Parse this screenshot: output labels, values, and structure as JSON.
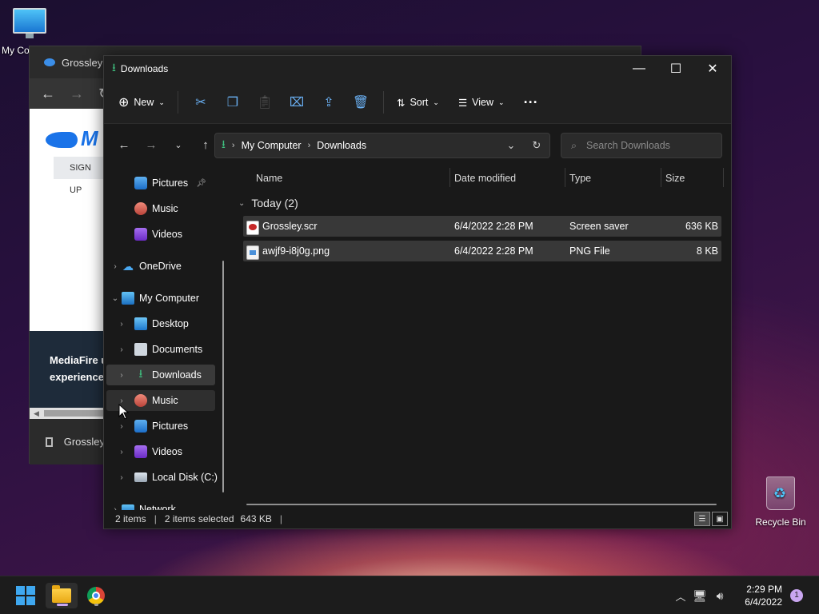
{
  "desktop": {
    "my_computer_label": "My Co",
    "recycle_bin_label": "Recycle Bin"
  },
  "background_window": {
    "tab_title": "Grossley",
    "signup_label": "SIGN UP",
    "promo_line1": "MediaFire u",
    "promo_line2": "experience.",
    "download_item": "Grossley"
  },
  "explorer": {
    "title": "Downloads",
    "commands": {
      "new": "New",
      "sort": "Sort",
      "view": "View"
    },
    "address": {
      "root": "My Computer",
      "folder": "Downloads"
    },
    "search_placeholder": "Search Downloads",
    "nav": {
      "pinned_pictures": "Pictures",
      "pinned_music": "Music",
      "pinned_videos": "Videos",
      "onedrive": "OneDrive",
      "my_computer": "My Computer",
      "desktop": "Desktop",
      "documents": "Documents",
      "downloads": "Downloads",
      "music": "Music",
      "pictures": "Pictures",
      "videos": "Videos",
      "local_disk": "Local Disk (C:)",
      "network": "Network"
    },
    "columns": {
      "name": "Name",
      "date": "Date modified",
      "type": "Type",
      "size": "Size"
    },
    "group_label": "Today (2)",
    "files": [
      {
        "name": "Grossley.scr",
        "date": "6/4/2022 2:28 PM",
        "type": "Screen saver",
        "size": "636 KB"
      },
      {
        "name": "awjf9-i8j0g.png",
        "date": "6/4/2022 2:28 PM",
        "type": "PNG File",
        "size": "8 KB"
      }
    ],
    "status": {
      "count": "2 items",
      "selected": "2 items selected",
      "size": "643 KB"
    }
  },
  "taskbar": {
    "time": "2:29 PM",
    "date": "6/4/2022",
    "notification_count": "1"
  },
  "colors": {
    "accent": "#3fa8f0",
    "selection": "#383838",
    "downloads_green": "#3fbf7f"
  }
}
